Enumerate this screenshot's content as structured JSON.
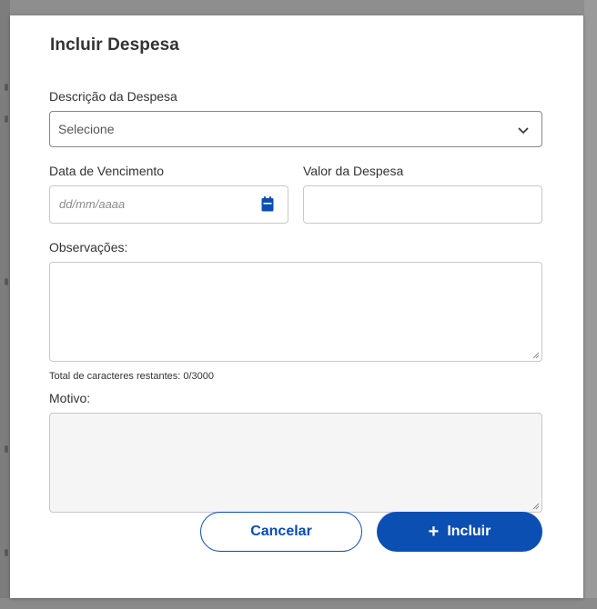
{
  "dialog": {
    "title": "Incluir Despesa"
  },
  "form": {
    "descricao": {
      "label": "Descrição da Despesa",
      "selected": "Selecione"
    },
    "vencimento": {
      "label": "Data de Vencimento",
      "placeholder": "dd/mm/aaaa",
      "icon": "calendar-icon"
    },
    "valor": {
      "label": "Valor da Despesa",
      "value": ""
    },
    "observacoes": {
      "label": "Observações:",
      "value": "",
      "counter": "Total de caracteres restantes: 0/3000"
    },
    "motivo": {
      "label": "Motivo:",
      "value": ""
    }
  },
  "actions": {
    "cancel_label": "Cancelar",
    "add_label": "Incluir",
    "add_icon": "plus-icon"
  },
  "colors": {
    "primary": "#0b4fb3",
    "disabled_bg": "#f5f5f5",
    "backdrop": "#8e8e8e"
  }
}
